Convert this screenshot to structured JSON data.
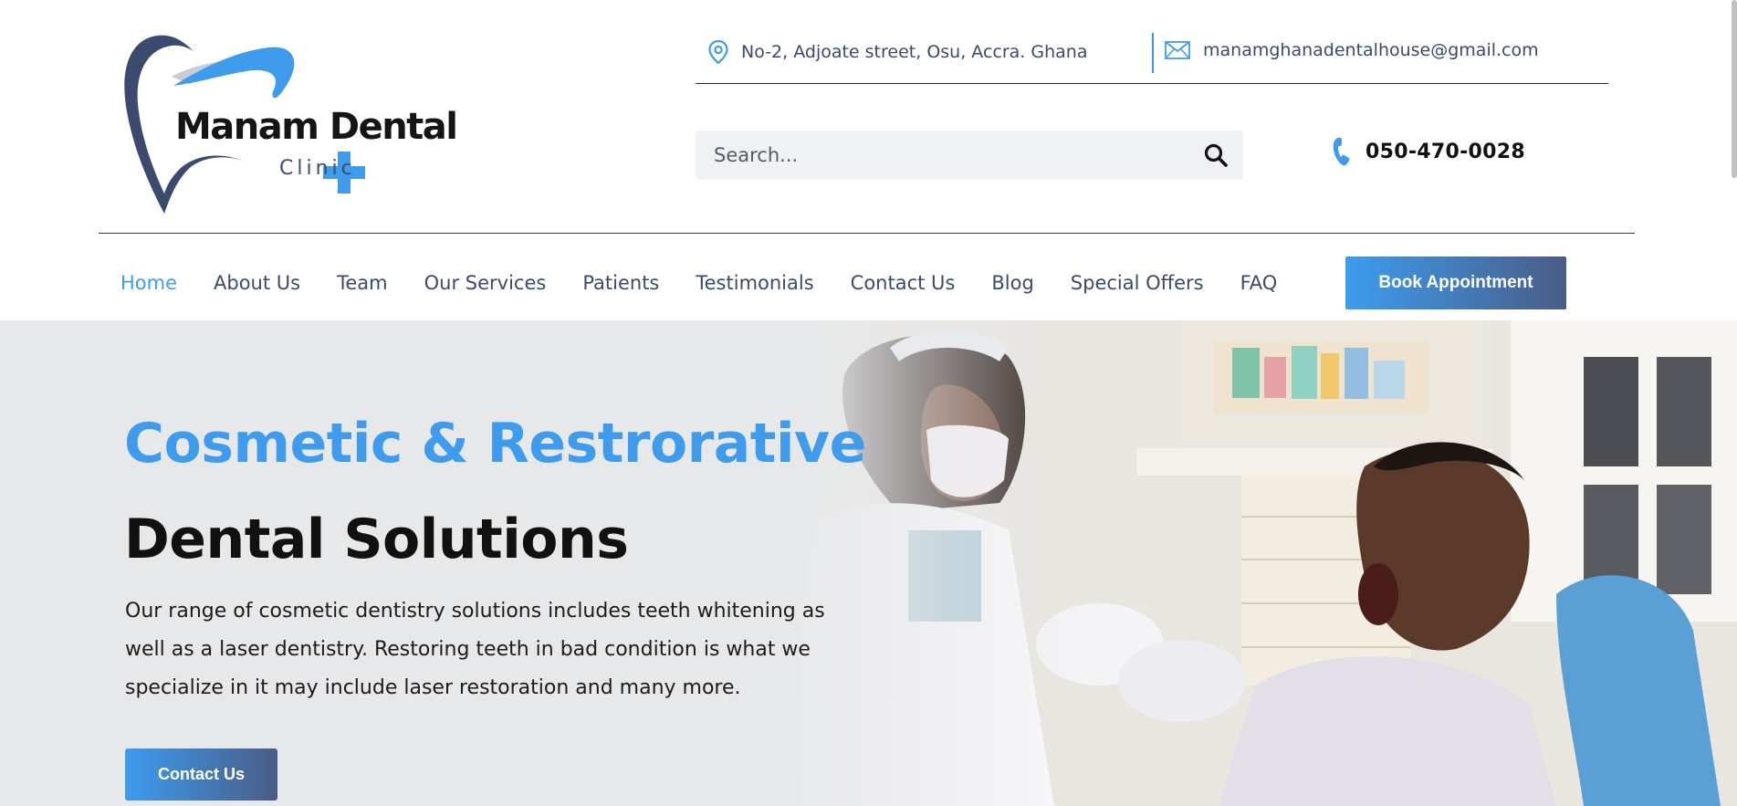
{
  "brand": {
    "name": "Manam Dental",
    "sub": "Clinic",
    "colors": {
      "accent": "#3F9BEC",
      "navy": "#3C4A6C",
      "gradient_end": "#4A5C86"
    }
  },
  "topbar": {
    "address": "No-2, Adjoate street, Osu, Accra. Ghana",
    "address_icon": "map-pin-icon",
    "email": "manamghanadentalhouse@gmail.com",
    "email_icon": "envelope-icon"
  },
  "search": {
    "placeholder": "Search...",
    "icon": "search-icon"
  },
  "phone": {
    "number": "050-470-0028",
    "icon": "phone-icon"
  },
  "nav": {
    "items": [
      {
        "label": "Home",
        "active": true
      },
      {
        "label": "About Us"
      },
      {
        "label": "Team"
      },
      {
        "label": "Our Services"
      },
      {
        "label": "Patients"
      },
      {
        "label": "Testimonials"
      },
      {
        "label": "Contact Us"
      },
      {
        "label": "Blog"
      },
      {
        "label": "Special Offers"
      },
      {
        "label": "FAQ"
      }
    ],
    "cta": "Book Appointment"
  },
  "hero": {
    "title_line1": "Cosmetic & Restrorative",
    "title_line2": "Dental Solutions",
    "description": "Our range of cosmetic dentistry solutions includes teeth whitening as well as a laser dentistry. Restoring teeth in bad condition is what we specialize in it may include laser restoration and many more.",
    "cta": "Contact Us"
  }
}
